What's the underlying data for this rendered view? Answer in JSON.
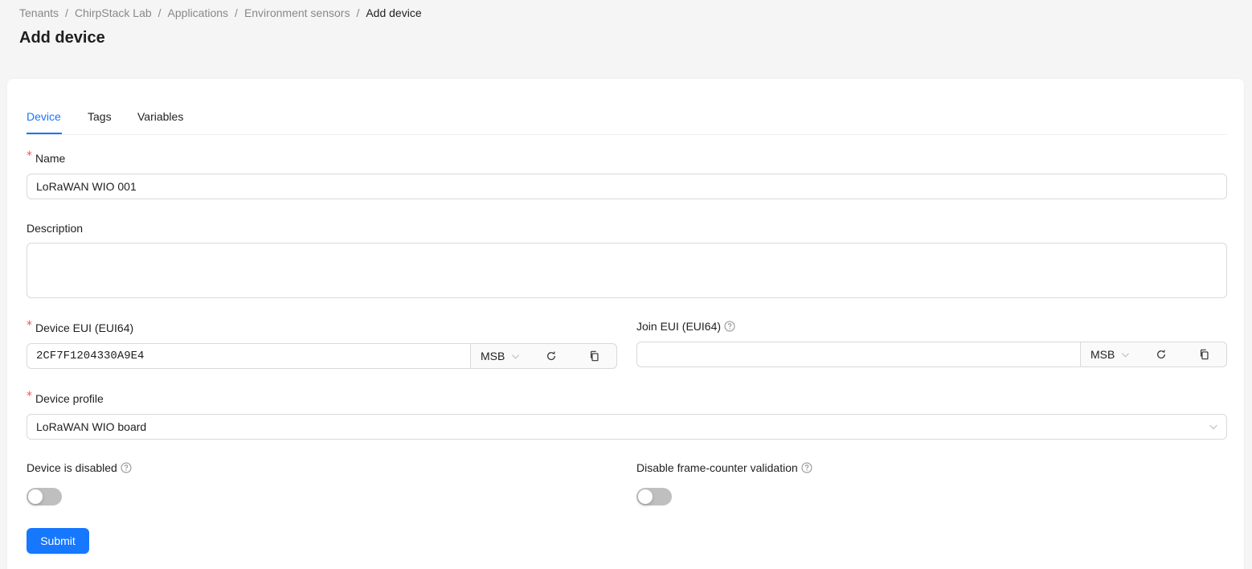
{
  "breadcrumb": {
    "items": [
      "Tenants",
      "ChirpStack Lab",
      "Applications",
      "Environment sensors",
      "Add device"
    ],
    "separator": "/"
  },
  "page": {
    "title": "Add device"
  },
  "tabs": [
    {
      "label": "Device",
      "active": true
    },
    {
      "label": "Tags",
      "active": false
    },
    {
      "label": "Variables",
      "active": false
    }
  ],
  "form": {
    "name": {
      "label": "Name",
      "required": true,
      "value": "LoRaWAN WIO 001"
    },
    "description": {
      "label": "Description",
      "required": false,
      "value": ""
    },
    "device_eui": {
      "label": "Device EUI (EUI64)",
      "required": true,
      "value": "2CF7F1204330A9E4",
      "byte_order": "MSB",
      "refresh_icon": "refresh-icon",
      "copy_icon": "copy-icon"
    },
    "join_eui": {
      "label": "Join EUI (EUI64)",
      "required": false,
      "value": "",
      "byte_order": "MSB",
      "help_icon": "question-circle-icon"
    },
    "device_profile": {
      "label": "Device profile",
      "required": true,
      "value": "LoRaWAN WIO board"
    },
    "device_disabled": {
      "label": "Device is disabled",
      "checked": false
    },
    "skip_fcnt": {
      "label": "Disable frame-counter validation",
      "checked": false
    },
    "submit_label": "Submit"
  },
  "colors": {
    "primary": "#1677ff",
    "required": "#ff4d4f",
    "switch_off": "rgba(0,0,0,0.25)"
  }
}
